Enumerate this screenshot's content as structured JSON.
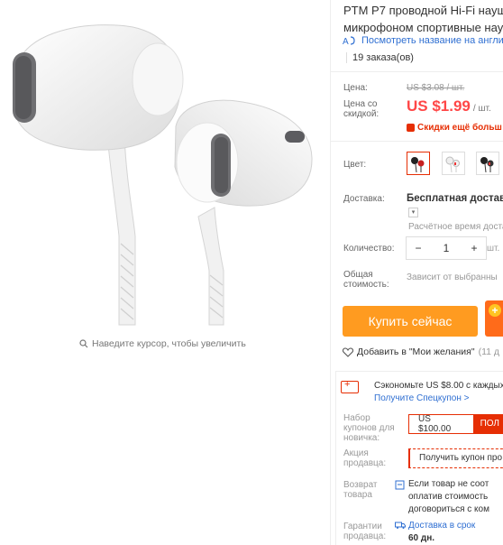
{
  "product": {
    "title_line1": "PTM P7 проводной Hi-Fi наушн",
    "title_line2": "микрофоном спортивные науш",
    "translate_link": "Посмотреть название на англи",
    "orders": "19 заказа(ов)"
  },
  "gallery": {
    "zoom_hint": "Наведите курсор, чтобы увеличить"
  },
  "price": {
    "label": "Цена:",
    "old_value": "US $3.08 / шт.",
    "discount_label_line1": "Цена со",
    "discount_label_line2": "скидкой:",
    "current_value": "US $1.99",
    "unit": "/ шт.",
    "more_discounts": "Скидки ещё больш"
  },
  "color": {
    "label": "Цвет:",
    "options": [
      "black-red",
      "white",
      "black"
    ]
  },
  "shipping": {
    "label": "Доставка:",
    "method": "Бесплатная доставка",
    "eta": "Расчётное время доста"
  },
  "quantity": {
    "label": "Количество:",
    "minus": "−",
    "value": "1",
    "plus": "+",
    "unit": "шт."
  },
  "total": {
    "label_line1": "Общая",
    "label_line2": "стоимость:",
    "note": "Зависит от выбранны"
  },
  "actions": {
    "buy_now": "Купить сейчас",
    "wishlist": "Добавить в \"Мои желания\"",
    "wishlist_count": "(11 д"
  },
  "coupon": {
    "save_text": "Сэкономьте US $8.00 с каждых",
    "special_link": "Получите Спецкупон >",
    "newbie_label_line1": "Набор",
    "newbie_label_line2": "купонов для",
    "newbie_label_line3": "новичка:",
    "newbie_amount": "US $100.00",
    "newbie_get": "ПОЛ",
    "store_label_line1": "Акция",
    "store_label_line2": "продавца:",
    "store_promo": "Получить купон про"
  },
  "returns": {
    "label_line1": "Возврат",
    "label_line2": "товара",
    "text_line1": "Если товар не соот",
    "text_line2": "оплатив стоимость",
    "text_line3": "договориться с ком"
  },
  "guarantee": {
    "label_line1": "Гарантии",
    "label_line2": "продавца:",
    "text_line1": "Доставка в срок",
    "text_line2": "60 дн."
  },
  "colors": {
    "accent": "#ff4747",
    "buy_button": "#ff9b20",
    "link": "#2f6fd2",
    "coupon_red": "#e62e04"
  }
}
